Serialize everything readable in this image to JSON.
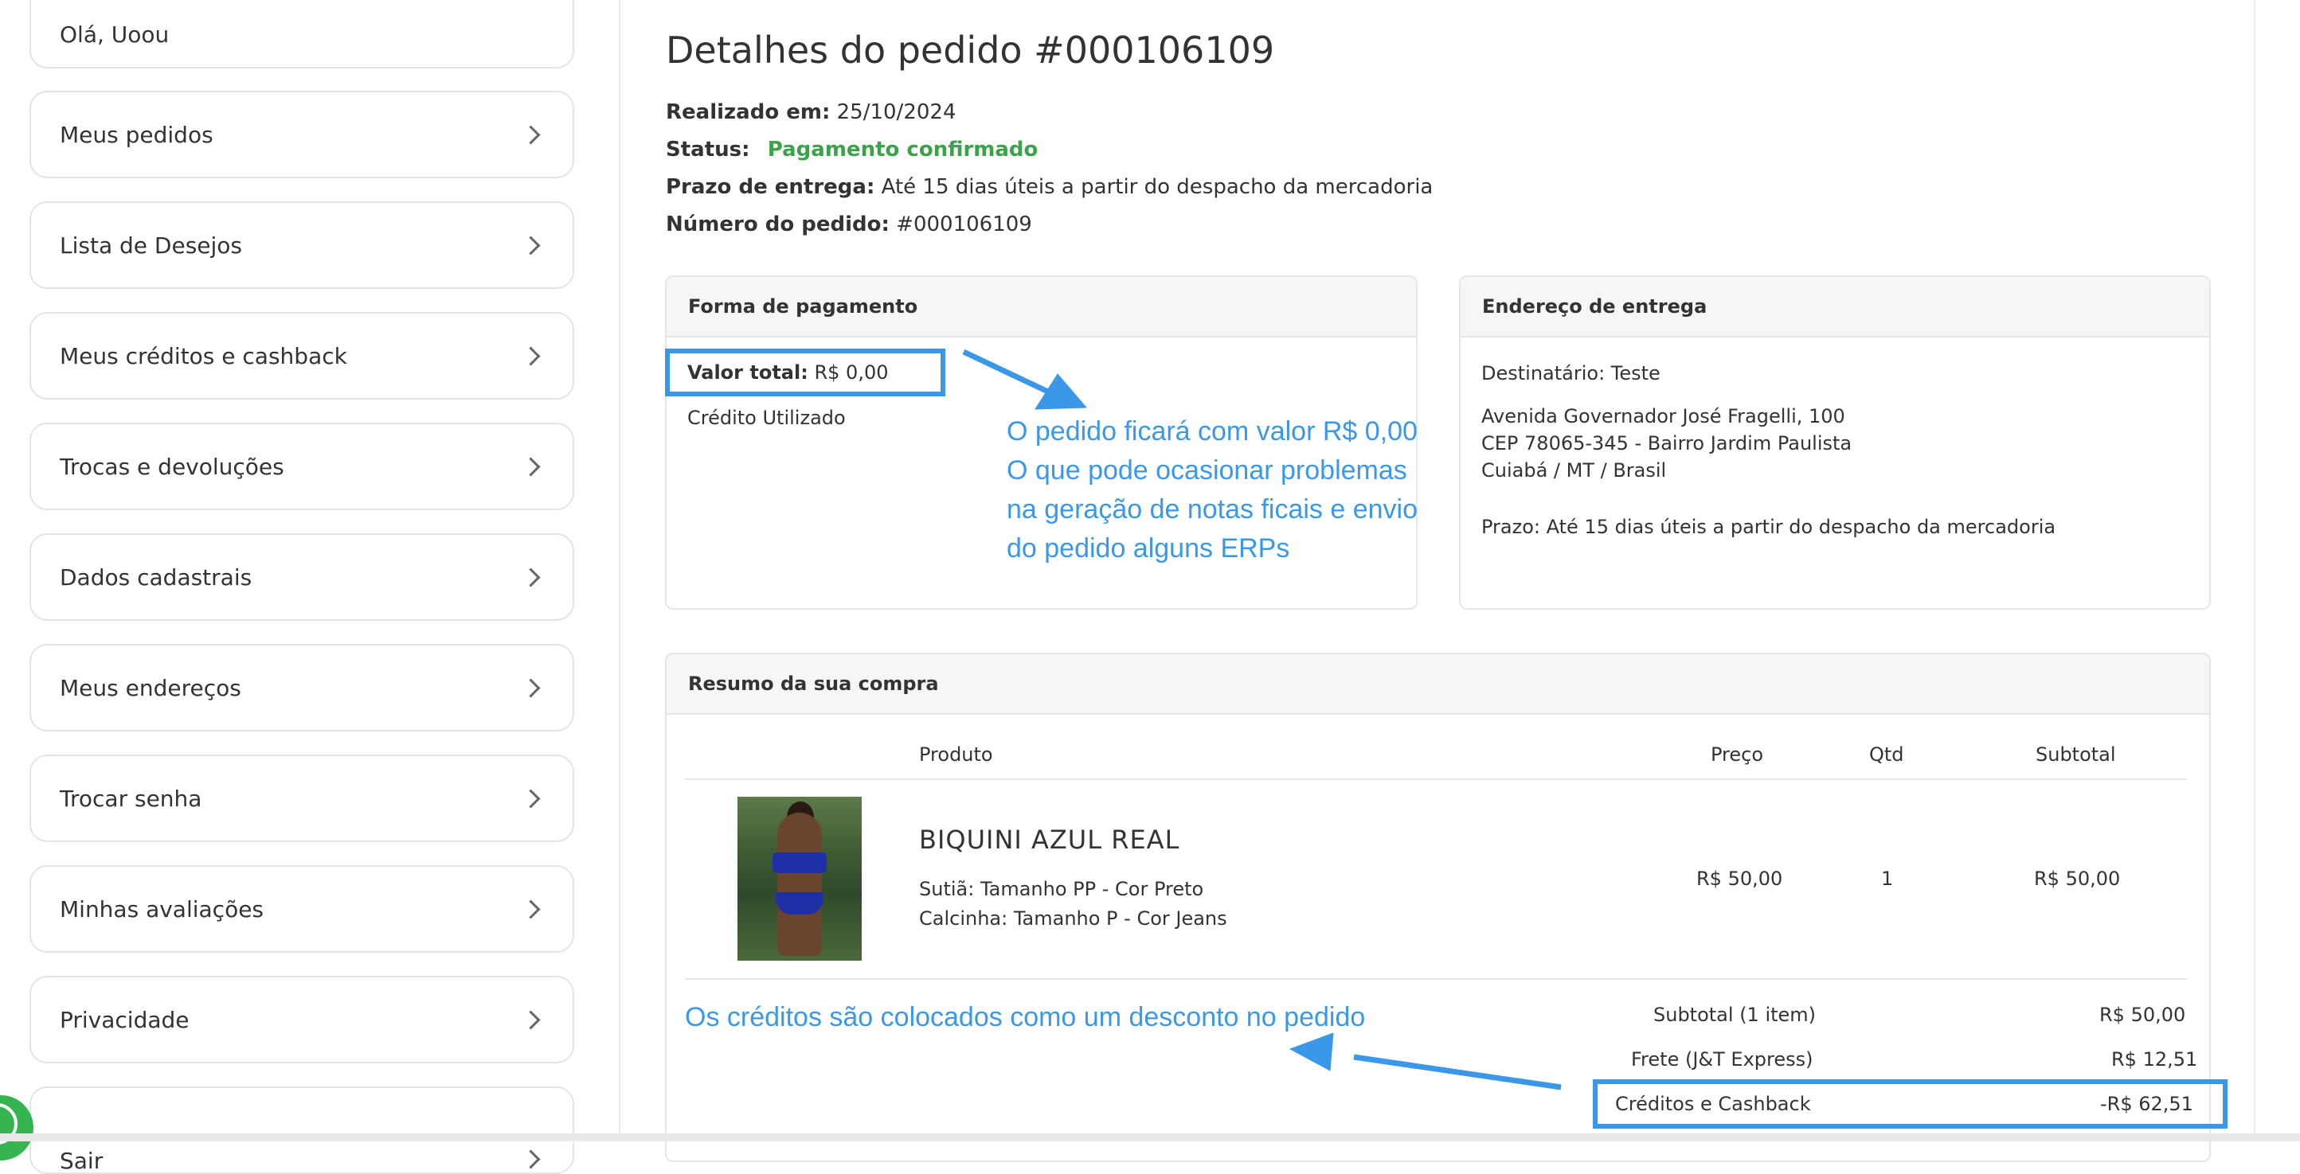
{
  "sidebar": {
    "greeting": "Olá, Uoou",
    "items": [
      {
        "label": "Meus pedidos"
      },
      {
        "label": "Lista de Desejos"
      },
      {
        "label": "Meus créditos e cashback"
      },
      {
        "label": "Trocas e devoluções"
      },
      {
        "label": "Dados cadastrais"
      },
      {
        "label": "Meus endereços"
      },
      {
        "label": "Trocar senha"
      },
      {
        "label": "Minhas avaliações"
      },
      {
        "label": "Privacidade"
      },
      {
        "label": "Sair"
      }
    ]
  },
  "order": {
    "title": "Detalhes do pedido #000106109",
    "placed_label": "Realizado em:",
    "placed_value": "25/10/2024",
    "status_label": "Status:",
    "status_value": "Pagamento confirmado",
    "deadline_label": "Prazo de entrega:",
    "deadline_value": "Até 15 dias úteis a partir do despacho da mercadoria",
    "number_label": "Número do pedido:",
    "number_value": "#000106109"
  },
  "payment": {
    "header": "Forma de pagamento",
    "total_label": "Valor total:",
    "total_value": "R$ 0,00",
    "method": "Crédito Utilizado"
  },
  "shipping": {
    "header": "Endereço de entrega",
    "recipient": "Destinatário: Teste",
    "line1": "Avenida Governador José Fragelli, 100",
    "line2": "CEP 78065-345 - Bairro Jardim Paulista",
    "line3": "Cuiabá / MT / Brasil",
    "deadline": "Prazo: Até 15 dias úteis a partir do despacho da mercadoria"
  },
  "summary": {
    "header": "Resumo da sua compra",
    "columns": {
      "product": "Produto",
      "price": "Preço",
      "qty": "Qtd",
      "subtotal": "Subtotal"
    },
    "item": {
      "name": "BIQUINI AZUL REAL",
      "variant1": "Sutiã: Tamanho PP - Cor Preto",
      "variant2": "Calcinha: Tamanho P - Cor Jeans",
      "price": "R$ 50,00",
      "qty": "1",
      "subtotal": "R$ 50,00"
    },
    "totals": [
      {
        "label": "Subtotal (1 item)",
        "value": "R$ 50,00"
      },
      {
        "label": "Frete (J&T Express)",
        "value": "R$ 12,51"
      },
      {
        "label": "Créditos e Cashback",
        "value": "-R$ 62,51"
      }
    ]
  },
  "annotations": {
    "note1_l1": "O pedido ficará com valor R$ 0,00",
    "note1_l2": "O que pode ocasionar problemas",
    "note1_l3": "na geração de notas ficais e envio",
    "note1_l4": "do pedido alguns ERPs",
    "note2": "Os créditos são colocados como um desconto no pedido",
    "color": "#3b98e8"
  },
  "colors": {
    "status_green": "#3aa34a",
    "annotation_blue": "#3b98e8"
  }
}
